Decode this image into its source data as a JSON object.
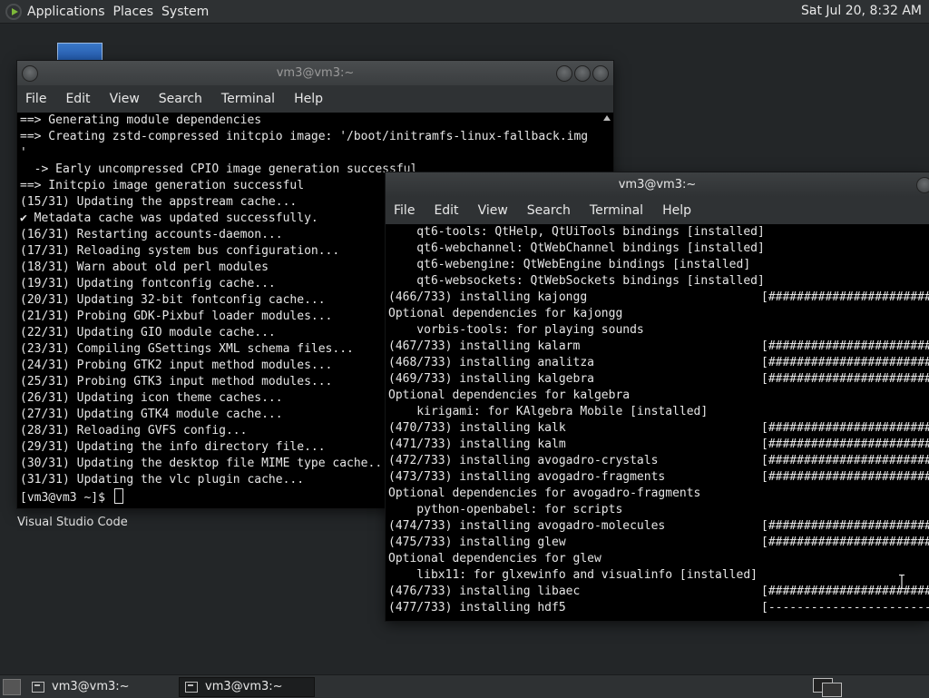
{
  "top_panel": {
    "applications": "Applications",
    "places": "Places",
    "system": "System",
    "clock": "Sat Jul 20,  8:32 AM"
  },
  "desktop": {
    "icon_label": "Visual Studio Code"
  },
  "window1": {
    "title": "vm3@vm3:~",
    "menu": [
      "File",
      "Edit",
      "View",
      "Search",
      "Terminal",
      "Help"
    ],
    "lines": [
      "==> Generating module dependencies",
      "==> Creating zstd-compressed initcpio image: '/boot/initramfs-linux-fallback.img",
      "'",
      "  -> Early uncompressed CPIO image generation successful",
      "==> Initcpio image generation successful",
      "(15/31) Updating the appstream cache...",
      "✔ Metadata cache was updated successfully.",
      "(16/31) Restarting accounts-daemon...",
      "(17/31) Reloading system bus configuration...",
      "(18/31) Warn about old perl modules",
      "(19/31) Updating fontconfig cache...",
      "(20/31) Updating 32-bit fontconfig cache...",
      "(21/31) Probing GDK-Pixbuf loader modules...",
      "(22/31) Updating GIO module cache...",
      "(23/31) Compiling GSettings XML schema files...",
      "(24/31) Probing GTK2 input method modules...",
      "(25/31) Probing GTK3 input method modules...",
      "(26/31) Updating icon theme caches...",
      "(27/31) Updating GTK4 module cache...",
      "(28/31) Reloading GVFS config...",
      "(29/31) Updating the info directory file...",
      "(30/31) Updating the desktop file MIME type cache...",
      "(31/31) Updating the vlc plugin cache..."
    ],
    "prompt": "[vm3@vm3 ~]$ "
  },
  "window2": {
    "title": "vm3@vm3:~",
    "menu": [
      "File",
      "Edit",
      "View",
      "Search",
      "Terminal",
      "Help"
    ],
    "lines": [
      {
        "text": "    qt6-tools: QtHelp, QtUiTools bindings [installed]",
        "bar": ""
      },
      {
        "text": "    qt6-webchannel: QtWebChannel bindings [installed]",
        "bar": ""
      },
      {
        "text": "    qt6-webengine: QtWebEngine bindings [installed]",
        "bar": ""
      },
      {
        "text": "    qt6-websockets: QtWebSockets bindings [installed]",
        "bar": ""
      },
      {
        "text": "(466/733) installing kajongg",
        "bar": "[#######################"
      },
      {
        "text": "Optional dependencies for kajongg",
        "bar": ""
      },
      {
        "text": "    vorbis-tools: for playing sounds",
        "bar": ""
      },
      {
        "text": "(467/733) installing kalarm",
        "bar": "[#######################"
      },
      {
        "text": "(468/733) installing analitza",
        "bar": "[#######################"
      },
      {
        "text": "(469/733) installing kalgebra",
        "bar": "[#######################"
      },
      {
        "text": "Optional dependencies for kalgebra",
        "bar": ""
      },
      {
        "text": "    kirigami: for KAlgebra Mobile [installed]",
        "bar": ""
      },
      {
        "text": "(470/733) installing kalk",
        "bar": "[#######################"
      },
      {
        "text": "(471/733) installing kalm",
        "bar": "[#######################"
      },
      {
        "text": "(472/733) installing avogadro-crystals",
        "bar": "[#######################"
      },
      {
        "text": "(473/733) installing avogadro-fragments",
        "bar": "[#######################"
      },
      {
        "text": "Optional dependencies for avogadro-fragments",
        "bar": ""
      },
      {
        "text": "    python-openbabel: for scripts",
        "bar": ""
      },
      {
        "text": "(474/733) installing avogadro-molecules",
        "bar": "[#######################"
      },
      {
        "text": "(475/733) installing glew",
        "bar": "[#######################"
      },
      {
        "text": "Optional dependencies for glew",
        "bar": ""
      },
      {
        "text": "    libx11: for glxewinfo and visualinfo [installed]",
        "bar": ""
      },
      {
        "text": "(476/733) installing libaec",
        "bar": "[#######################"
      },
      {
        "text": "(477/733) installing hdf5",
        "bar": "[-----------------------"
      }
    ]
  },
  "taskbar": {
    "tasks": [
      {
        "label": "vm3@vm3:~"
      },
      {
        "label": "vm3@vm3:~"
      }
    ]
  }
}
